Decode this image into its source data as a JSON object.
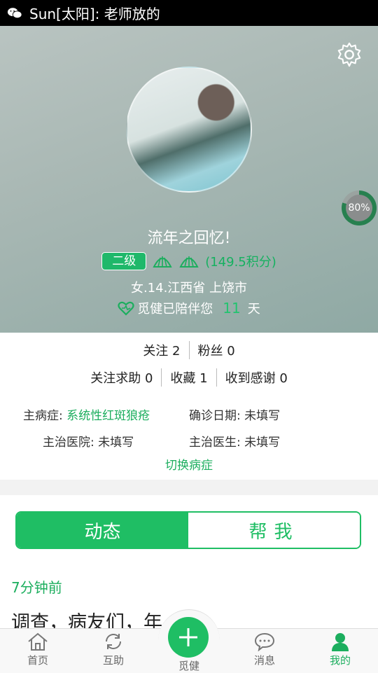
{
  "statusbar": {
    "icon": "wechat-icon",
    "text": "Sun[太阳]: 老师放的"
  },
  "profile": {
    "username": "流年之回忆!",
    "level": "二级",
    "points": "(149.5积分)",
    "info": "女.14.江西省 上饶市",
    "accompany_prefix": "觅健已陪伴您",
    "accompany_days": "11",
    "accompany_suffix": "天",
    "progress_label": "80%",
    "progress_value": 0.8
  },
  "stats": {
    "follow": "关注 2",
    "fans": "粉丝 0",
    "help_follow": "关注求助 0",
    "favorites": "收藏 1",
    "thanks": "收到感谢 0"
  },
  "medical": {
    "disease_label": "主病症:",
    "disease_value": "系统性红斑狼疮",
    "diagnosis_label": "确诊日期:",
    "diagnosis_value": "未填写",
    "hospital_label": "主治医院:",
    "hospital_value": "未填写",
    "doctor_label": "主治医生:",
    "doctor_value": "未填写",
    "switch_label": "切换病症"
  },
  "tabs": {
    "active": "动态",
    "inactive": "帮我"
  },
  "feed": {
    "time": "7分钟前",
    "text": "调查，病友们，年"
  },
  "nav": {
    "home": "首页",
    "mutual": "互助",
    "center": "觅健",
    "messages": "消息",
    "mine": "我的"
  },
  "colors": {
    "accent": "#1fbe64",
    "text_green": "#1cae5e"
  }
}
